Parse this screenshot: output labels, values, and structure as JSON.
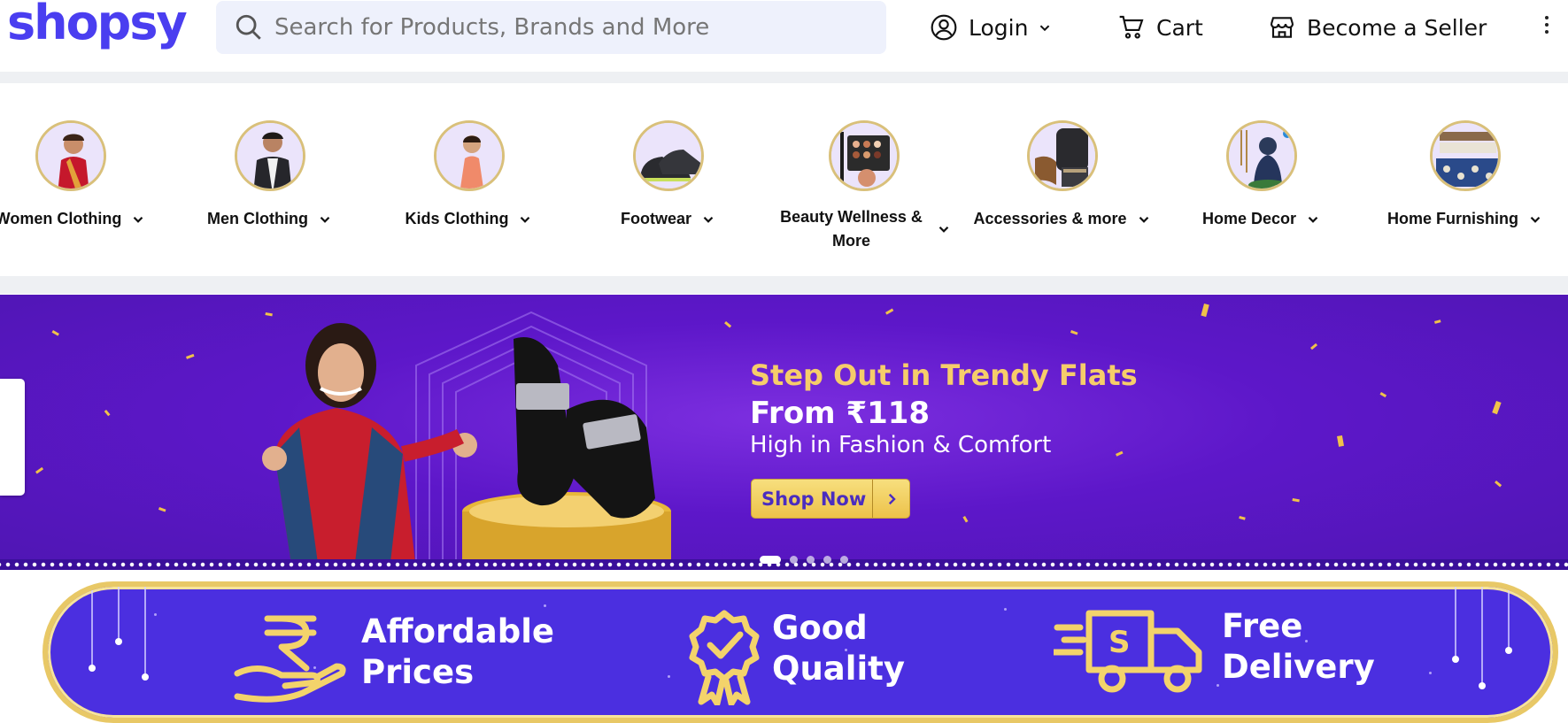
{
  "header": {
    "logo": "shopsy",
    "search_placeholder": "Search for Products, Brands and More",
    "login_label": "Login",
    "cart_label": "Cart",
    "seller_label": "Become a Seller"
  },
  "categories": [
    {
      "label": "Women Clothing"
    },
    {
      "label": "Men Clothing"
    },
    {
      "label": "Kids Clothing"
    },
    {
      "label": "Footwear"
    },
    {
      "label": "Beauty Wellness & More"
    },
    {
      "label": "Accessories & more"
    },
    {
      "label": "Home Decor"
    },
    {
      "label": "Home Furnishing"
    }
  ],
  "banner": {
    "title": "Step Out in Trendy Flats",
    "price": "From ₹118",
    "subtitle": "High in Fashion & Comfort",
    "cta": "Shop Now",
    "slides": 6,
    "active_slide": 1
  },
  "value_props": [
    {
      "line1": "Affordable",
      "line2": "Prices",
      "icon": "rupee-hand-icon"
    },
    {
      "line1": "Good",
      "line2": "Quality",
      "icon": "quality-badge-icon"
    },
    {
      "line1": "Free",
      "line2": "Delivery",
      "icon": "delivery-truck-icon"
    }
  ],
  "colors": {
    "brand": "#4a3ef0",
    "banner_bg": "#5d17c9",
    "accent_gold": "#f6cd6a"
  }
}
